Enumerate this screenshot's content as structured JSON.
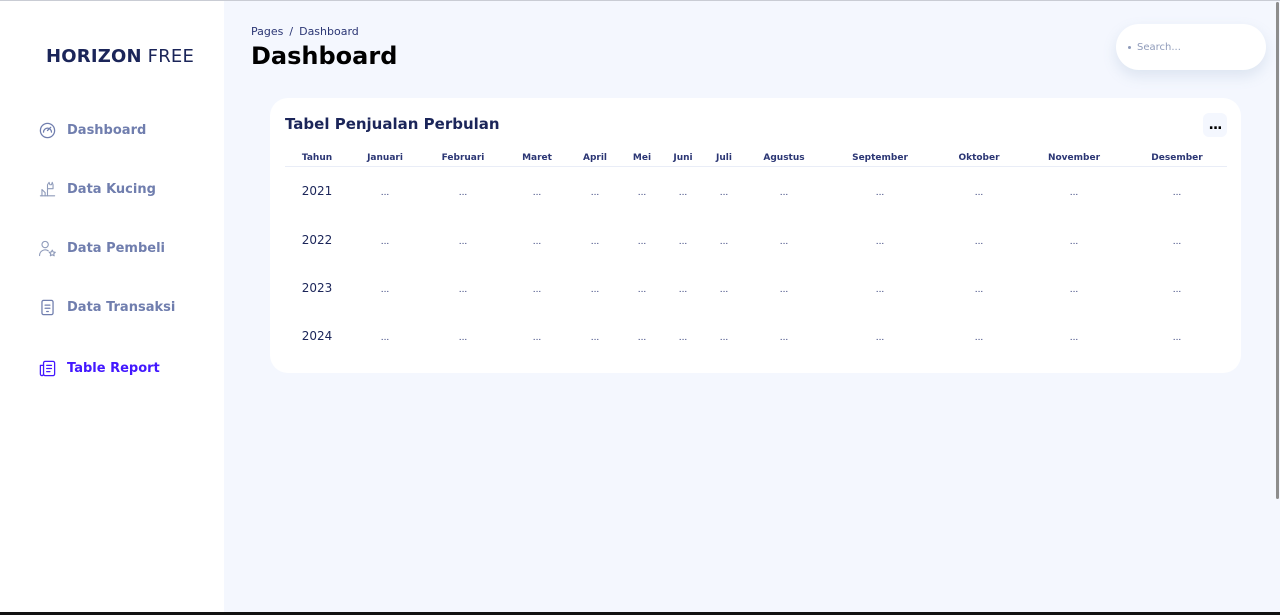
{
  "sidebar": {
    "logo_bold": "HORIZON",
    "logo_light": "FREE",
    "items": [
      {
        "label": "Dashboard",
        "icon": "gauge-icon",
        "active": false
      },
      {
        "label": "Data Kucing",
        "icon": "cat-icon",
        "active": false
      },
      {
        "label": "Data Pembeli",
        "icon": "user-star-icon",
        "active": false
      },
      {
        "label": "Data Transaksi",
        "icon": "receipt-icon",
        "active": false
      },
      {
        "label": "Table Report",
        "icon": "report-icon",
        "active": true
      }
    ]
  },
  "header": {
    "breadcrumb_root": "Pages",
    "breadcrumb_separator": "/",
    "breadcrumb_current": "Dashboard",
    "title": "Dashboard"
  },
  "search": {
    "placeholder": "Search...",
    "value": ""
  },
  "card": {
    "title": "Tabel Penjualan Perbulan",
    "menu_label": "..."
  },
  "table": {
    "columns": [
      "Tahun",
      "Januari",
      "Februari",
      "Maret",
      "April",
      "Mei",
      "Juni",
      "Juli",
      "Agustus",
      "September",
      "Oktober",
      "November",
      "Desember"
    ],
    "rows": [
      {
        "year": "2021",
        "cells": [
          "...",
          "...",
          "...",
          "...",
          "...",
          "...",
          "...",
          "...",
          "...",
          "...",
          "...",
          "..."
        ]
      },
      {
        "year": "2022",
        "cells": [
          "...",
          "...",
          "...",
          "...",
          "...",
          "...",
          "...",
          "...",
          "...",
          "...",
          "...",
          "..."
        ]
      },
      {
        "year": "2023",
        "cells": [
          "...",
          "...",
          "...",
          "...",
          "...",
          "...",
          "...",
          "...",
          "...",
          "...",
          "...",
          "..."
        ]
      },
      {
        "year": "2024",
        "cells": [
          "...",
          "...",
          "...",
          "...",
          "...",
          "...",
          "...",
          "...",
          "...",
          "...",
          "...",
          "..."
        ]
      }
    ]
  },
  "colors": {
    "accent": "#4318ff",
    "text_primary": "#1b2559",
    "text_muted": "#707eae",
    "page_bg": "#f4f7fe",
    "card_bg": "#ffffff"
  }
}
